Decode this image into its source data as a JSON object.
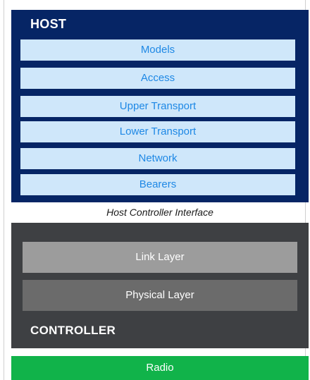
{
  "host": {
    "title": "HOST",
    "layers": [
      {
        "label": "Models"
      },
      {
        "label": "Access"
      },
      {
        "label": "Upper Transport"
      },
      {
        "label": "Lower Transport"
      },
      {
        "label": "Network"
      },
      {
        "label": "Bearers"
      }
    ]
  },
  "hci": {
    "label": "Host Controller Interface"
  },
  "controller": {
    "title": "CONTROLLER",
    "layers": [
      {
        "label": "Link Layer"
      },
      {
        "label": "Physical Layer"
      }
    ]
  },
  "radio": {
    "label": "Radio"
  },
  "colors": {
    "host_background": "#062565",
    "host_layer_fill": "#cfe7fa",
    "host_layer_text": "#1e88e5",
    "controller_background": "#3e4043",
    "link_layer_fill": "#9c9c9c",
    "physical_layer_fill": "#6b6b6b",
    "radio_fill": "#11b34a"
  }
}
